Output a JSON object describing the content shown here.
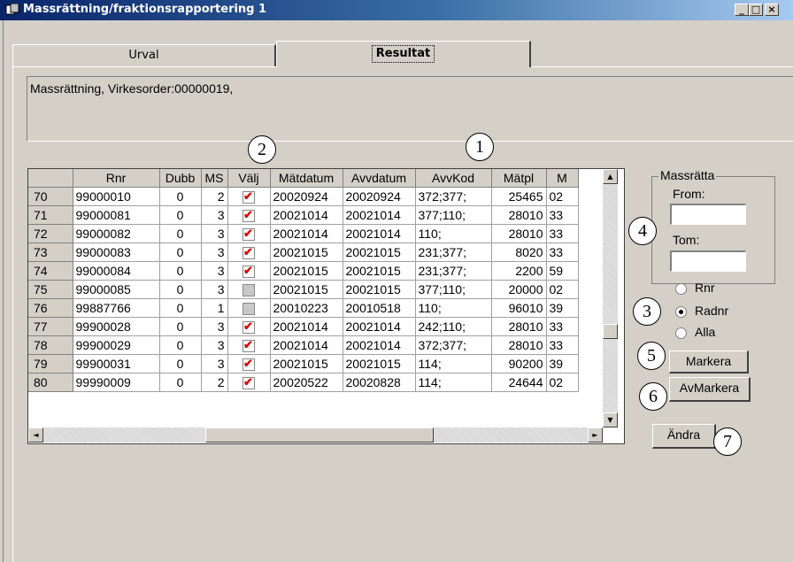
{
  "window": {
    "title": "Massrättning/fraktionsrapportering 1",
    "min_label": "_",
    "max_label": "□",
    "close_label": "×"
  },
  "tabs": [
    {
      "label": "Urval",
      "active": false
    },
    {
      "label": "Resultat",
      "active": true
    }
  ],
  "info": {
    "text": "Massrättning, Virkesorder:00000019,"
  },
  "grid": {
    "columns": [
      "",
      "Rnr",
      "Dubb",
      "MS",
      "Välj",
      "Mätdatum",
      "Avvdatum",
      "AvvKod",
      "Mätpl",
      "M"
    ],
    "rows": [
      {
        "row": "70",
        "rnr": "99000010",
        "dubb": "0",
        "ms": "2",
        "valj": true,
        "matdatum": "20020924",
        "avvdatum": "20020924",
        "avvkod": "372;377;",
        "matpl": "25465",
        "m": "02"
      },
      {
        "row": "71",
        "rnr": "99000081",
        "dubb": "0",
        "ms": "3",
        "valj": true,
        "matdatum": "20021014",
        "avvdatum": "20021014",
        "avvkod": "377;110;",
        "matpl": "28010",
        "m": "33"
      },
      {
        "row": "72",
        "rnr": "99000082",
        "dubb": "0",
        "ms": "3",
        "valj": true,
        "matdatum": "20021014",
        "avvdatum": "20021014",
        "avvkod": "110;",
        "matpl": "28010",
        "m": "33"
      },
      {
        "row": "73",
        "rnr": "99000083",
        "dubb": "0",
        "ms": "3",
        "valj": true,
        "matdatum": "20021015",
        "avvdatum": "20021015",
        "avvkod": "231;377;",
        "matpl": "8020",
        "m": "33"
      },
      {
        "row": "74",
        "rnr": "99000084",
        "dubb": "0",
        "ms": "3",
        "valj": true,
        "matdatum": "20021015",
        "avvdatum": "20021015",
        "avvkod": "231;377;",
        "matpl": "2200",
        "m": "59"
      },
      {
        "row": "75",
        "rnr": "99000085",
        "dubb": "0",
        "ms": "3",
        "valj": false,
        "matdatum": "20021015",
        "avvdatum": "20021015",
        "avvkod": "377;110;",
        "matpl": "20000",
        "m": "02"
      },
      {
        "row": "76",
        "rnr": "99887766",
        "dubb": "0",
        "ms": "1",
        "valj": false,
        "matdatum": "20010223",
        "avvdatum": "20010518",
        "avvkod": "110;",
        "matpl": "96010",
        "m": "39"
      },
      {
        "row": "77",
        "rnr": "99900028",
        "dubb": "0",
        "ms": "3",
        "valj": true,
        "matdatum": "20021014",
        "avvdatum": "20021014",
        "avvkod": "242;110;",
        "matpl": "28010",
        "m": "33"
      },
      {
        "row": "78",
        "rnr": "99900029",
        "dubb": "0",
        "ms": "3",
        "valj": true,
        "matdatum": "20021014",
        "avvdatum": "20021014",
        "avvkod": "372;377;",
        "matpl": "28010",
        "m": "33"
      },
      {
        "row": "79",
        "rnr": "99900031",
        "dubb": "0",
        "ms": "3",
        "valj": true,
        "matdatum": "20021015",
        "avvdatum": "20021015",
        "avvkod": "114;",
        "matpl": "90200",
        "m": "39"
      },
      {
        "row": "80",
        "rnr": "99990009",
        "dubb": "0",
        "ms": "2",
        "valj": true,
        "matdatum": "20020522",
        "avvdatum": "20020828",
        "avvkod": "114;",
        "matpl": "24644",
        "m": "02"
      }
    ]
  },
  "scroll": {
    "up": "▲",
    "down": "▼",
    "left": "◄",
    "right": "►"
  },
  "massratta": {
    "title": "Massrätta",
    "from_label": "From:",
    "from_value": "",
    "tom_label": "Tom:",
    "tom_value": "",
    "options": [
      {
        "label": "Rnr",
        "selected": false
      },
      {
        "label": "Radnr",
        "selected": true
      },
      {
        "label": "Alla",
        "selected": false
      }
    ],
    "markera": "Markera",
    "avmarkera": "AvMarkera",
    "andra": "Ändra"
  },
  "callouts": [
    "1",
    "2",
    "3",
    "4",
    "5",
    "6",
    "7"
  ],
  "colors": {
    "titlebar_start": "#0a246a",
    "titlebar_end": "#a6caf0",
    "face": "#d4d0c8",
    "check_mark": "#e00000"
  }
}
